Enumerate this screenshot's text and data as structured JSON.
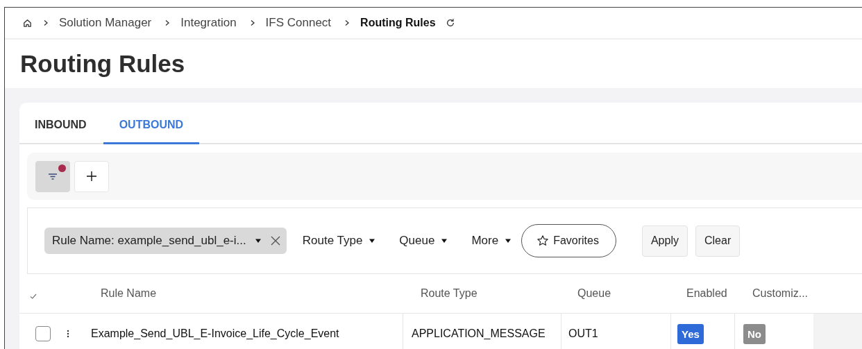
{
  "breadcrumb": [
    "Solution Manager",
    "Integration",
    "IFS Connect",
    "Routing Rules"
  ],
  "page_title": "Routing Rules",
  "tabs": [
    {
      "label": "INBOUND",
      "selected": false
    },
    {
      "label": "OUTBOUND",
      "selected": true
    }
  ],
  "toolbar": {
    "filter_active": true
  },
  "filters": {
    "chip": "Rule Name: example_send_ubl_e-i...",
    "dropdowns": [
      "Route Type",
      "Queue",
      "More"
    ],
    "favorites": "Favorites",
    "buttons": [
      "Apply",
      "Clear"
    ]
  },
  "table": {
    "columns": [
      "Rule Name",
      "Route Type",
      "Queue",
      "Enabled",
      "Customiz..."
    ],
    "rows": [
      {
        "selected": false,
        "rule_name": "Example_Send_UBL_E-Invoice_Life_Cycle_Event",
        "route_type": "APPLICATION_MESSAGE",
        "queue": "OUT1",
        "enabled": {
          "text": "Yes",
          "on": true
        },
        "customized": {
          "text": "No",
          "on": false
        }
      }
    ]
  }
}
